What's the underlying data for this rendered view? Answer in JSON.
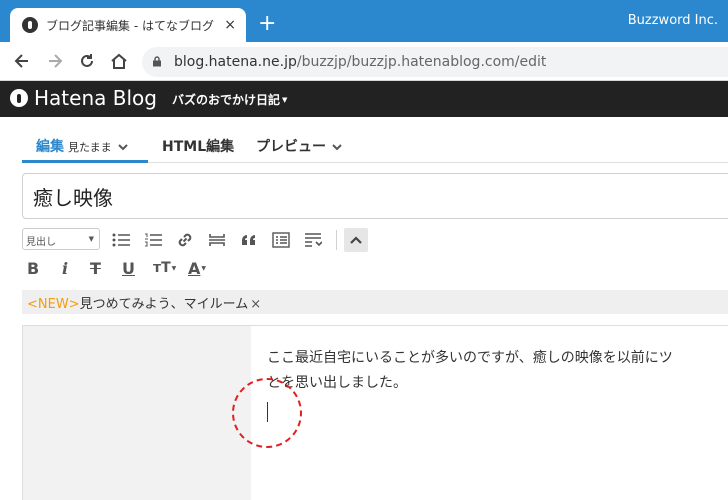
{
  "browser": {
    "tab_title": "ブログ記事編集 - はてなブログ",
    "tab_close": "×",
    "new_tab": "+",
    "profile_label": "Buzzword Inc.",
    "url_host": "blog.hatena.ne.jp",
    "url_path": "/buzzjp/buzzjp.hatenablog.com/edit"
  },
  "header": {
    "logo_text": "Hatena Blog",
    "blog_name": "バズのおでかけ日記"
  },
  "editor_tabs": {
    "edit_label": "編集",
    "edit_mode": "見たまま",
    "html_label": "HTML編集",
    "preview_label": "プレビュー"
  },
  "article": {
    "title": "癒し映像",
    "body_line1": "ここ最近自宅にいることが多いのですが、癒しの映像を以前にツ",
    "body_line2": "とを思い出しました。"
  },
  "toolbar": {
    "heading_select": "見出し",
    "bold": "B",
    "italic": "i",
    "strike": "T",
    "underline": "U",
    "text_size": "тT",
    "text_color": "A"
  },
  "keyword": {
    "new_badge": "<NEW>",
    "text": "見つめてみよう、マイルーム",
    "close": "×"
  },
  "colors": {
    "titlebar": "#2b88cf",
    "header_bg": "#222222",
    "accent": "#2c87cb",
    "highlight": "#e02020"
  }
}
